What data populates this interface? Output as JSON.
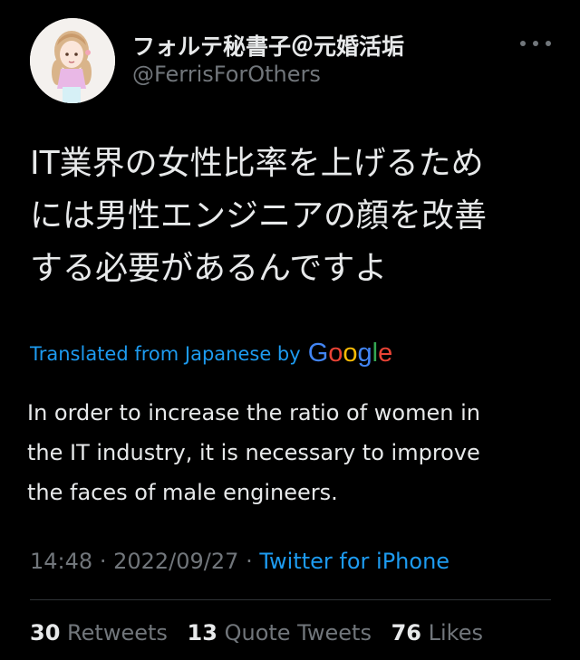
{
  "author": {
    "display_name": "フォルテ秘書子＠元婚活垢",
    "handle": "@FerrisForOthers",
    "avatar_icon": "avatar-illustration-icon"
  },
  "tweet": {
    "lines": [
      "IT業界の女性比率を上げるため",
      "には男性エンジニアの顔を改善",
      "する必要があるんですよ"
    ]
  },
  "translation": {
    "label": "Translated from Japanese by",
    "provider": "Google",
    "lines": [
      "In order to increase the ratio of women in",
      "the IT industry, it is necessary to improve",
      "the faces of male engineers."
    ]
  },
  "meta": {
    "time": "14:48",
    "separator": "·",
    "date": "2022/09/27",
    "source": "Twitter for iPhone"
  },
  "stats": {
    "retweets_count": "30",
    "retweets_label": "Retweets",
    "quotes_count": "13",
    "quotes_label": "Quote Tweets",
    "likes_count": "76",
    "likes_label": "Likes"
  },
  "colors": {
    "background": "#000000",
    "text": "#e7e9ea",
    "secondary": "#71767b",
    "link": "#1d9bf0",
    "google_blue": "#4285f4",
    "google_red": "#ea4335",
    "google_yellow": "#fbbc05",
    "google_green": "#34a853"
  }
}
